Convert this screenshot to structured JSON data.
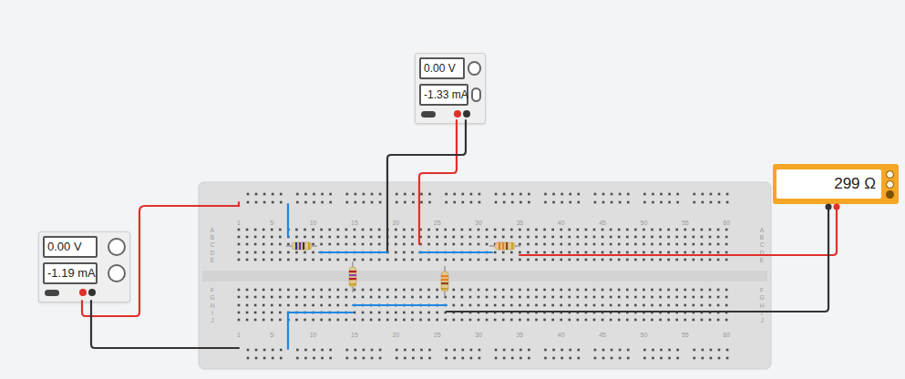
{
  "supplies": [
    {
      "name": "left-supply",
      "voltage": "0.00 V",
      "current": "-1.19 mA"
    },
    {
      "name": "top-supply",
      "voltage": "0.00 V",
      "current": "-1.33 mA"
    }
  ],
  "multimeter": {
    "reading": "299 Ω"
  },
  "breadboard": {
    "columns": [
      "1",
      "5",
      "10",
      "15",
      "20",
      "25",
      "30",
      "35",
      "40",
      "45",
      "50",
      "55",
      "60"
    ],
    "rows": [
      "A",
      "B",
      "C",
      "D",
      "E",
      "F",
      "G",
      "H",
      "I",
      "J"
    ]
  },
  "resistors": [
    {
      "kind": "horizontal",
      "bands": [
        "#1f3a93",
        "#6b2fa0",
        "#3a3a3a",
        "#c9a227"
      ]
    },
    {
      "kind": "vertical",
      "bands": [
        "#b22222",
        "#8e44ad",
        "#b22222",
        "#c9a227"
      ]
    },
    {
      "kind": "vertical",
      "bands": [
        "#e67e22",
        "#e67e22",
        "#8b4513",
        "#c9a227"
      ]
    },
    {
      "kind": "horizontal",
      "bands": [
        "#e67e22",
        "#e67e22",
        "#8b4513",
        "#c9a227"
      ]
    }
  ],
  "wires": [
    {
      "color": "#e0302a"
    },
    {
      "color": "#333333"
    },
    {
      "color": "#e0302a"
    },
    {
      "color": "#333333"
    },
    {
      "color": "#e0302a"
    },
    {
      "color": "#333333"
    },
    {
      "color": "#1e88e5"
    },
    {
      "color": "#1e88e5"
    },
    {
      "color": "#1e88e5"
    },
    {
      "color": "#1e88e5"
    },
    {
      "color": "#1e88e5"
    }
  ]
}
